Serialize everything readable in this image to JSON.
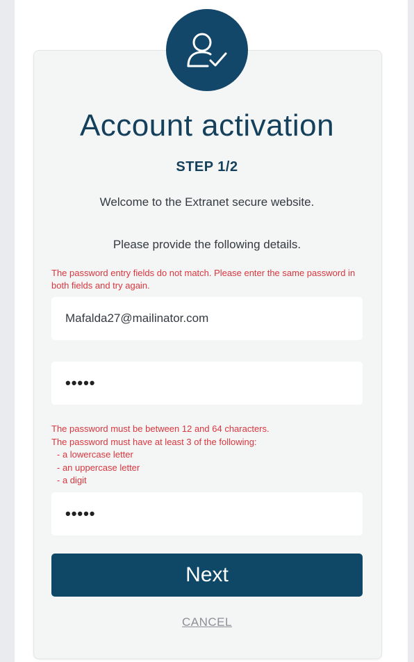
{
  "header": {
    "icon": "user-check-icon",
    "title": "Account activation",
    "step": "STEP 1/2"
  },
  "intro": {
    "welcome": "Welcome to the Extranet secure website.",
    "provide": "Please provide the following details."
  },
  "errors": {
    "mismatch": "The password entry fields do not match. Please enter the same password in both fields and try again.",
    "rules": [
      "The password must be between 12 and 64 characters.",
      "The password must have at least 3 of the following:",
      "- a lowercase letter",
      "- an uppercase letter",
      "- a digit"
    ]
  },
  "form": {
    "email_value": "Mafalda27@mailinator.com",
    "password_value": "•••••",
    "confirm_password_value": "•••••",
    "next_label": "Next",
    "cancel_label": "CANCEL"
  },
  "colors": {
    "brand": "#12476a",
    "button": "#0f4767",
    "error": "#d9363e",
    "text": "#333a40"
  }
}
